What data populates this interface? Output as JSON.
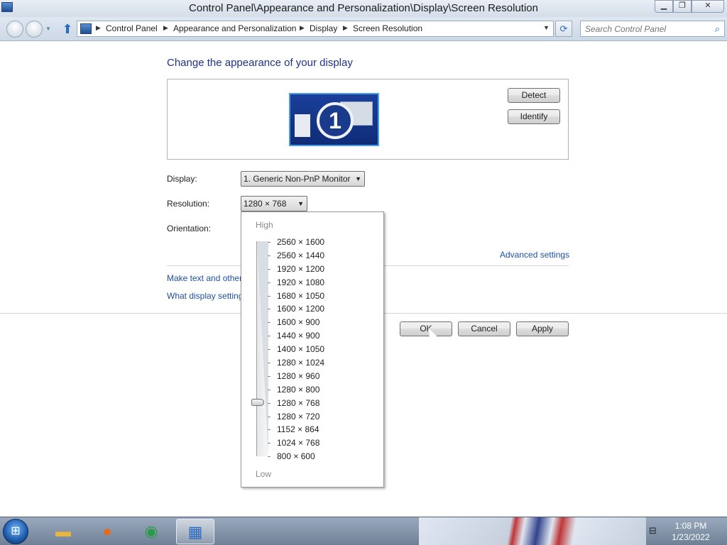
{
  "window": {
    "title": "Control Panel\\Appearance and Personalization\\Display\\Screen Resolution",
    "minimize": "▁",
    "maximize": "❐",
    "close": "✕"
  },
  "addressbar": {
    "breadcrumbs": [
      "Control Panel",
      "Appearance and Personalization",
      "Display",
      "Screen Resolution"
    ],
    "separator": "▶",
    "search_placeholder": "Search Control Panel"
  },
  "main": {
    "heading": "Change the appearance of your display",
    "monitor_number": "1",
    "detect_label": "Detect",
    "identify_label": "Identify",
    "display_label": "Display:",
    "display_value": "1. Generic Non-PnP Monitor",
    "resolution_label": "Resolution:",
    "resolution_value": "1280 × 768",
    "orientation_label": "Orientation:",
    "advanced_link": "Advanced settings",
    "link_text_size": "Make text and other",
    "link_what_settings": "What display setting",
    "ok_label": "OK",
    "cancel_label": "Cancel",
    "apply_label": "Apply"
  },
  "resolution_dropdown": {
    "high_label": "High",
    "low_label": "Low",
    "options": [
      "2560 × 1600",
      "2560 × 1440",
      "1920 × 1200",
      "1920 × 1080",
      "1680 × 1050",
      "1600 × 1200",
      "1600 × 900",
      "1440 × 900",
      "1400 × 1050",
      "1280 × 1024",
      "1280 × 960",
      "1280 × 800",
      "1280 × 768",
      "1280 × 720",
      "1152 × 864",
      "1024 × 768",
      "800 × 600"
    ],
    "selected": "1280 × 768"
  },
  "taskbar": {
    "items": [
      "start-orb",
      "windows-explorer-icon",
      "firefox-icon",
      "chrome-icon",
      "control-panel-icon"
    ],
    "time": "1:08 PM",
    "date": "1/23/2022"
  },
  "colors": {
    "heading_blue": "#1e3287",
    "link_blue": "#1e50a2",
    "monitor_blue": "#1a3f9b"
  }
}
